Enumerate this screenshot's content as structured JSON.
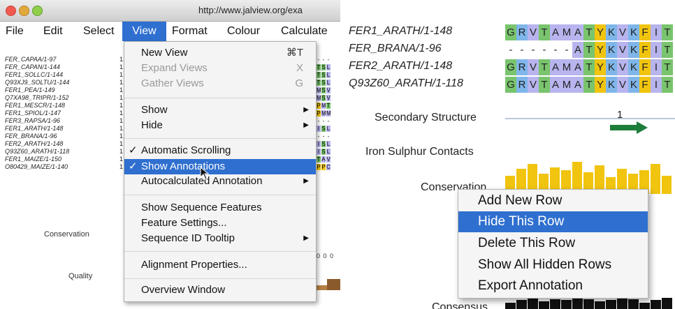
{
  "window": {
    "url": "http://www.jalview.org/exa"
  },
  "menubar": {
    "file": "File",
    "edit": "Edit",
    "select": "Select",
    "view": "View",
    "format": "Format",
    "colour": "Colour",
    "calculate": "Calculate"
  },
  "sequences": [
    "FER_CAPAA/1-97",
    "FER_CAPAN/1-144",
    "FER1_SOLLC/1-144",
    "Q93XJ9_SOLTU/1-144",
    "FER1_PEA/1-149",
    "Q7XA98_TRIPR/1-152",
    "FER1_MESCR/1-148",
    "FER1_SPIOL/1-147",
    "FER3_RAPSA/1-96",
    "FER1_ARATH/1-148",
    "FER_BRANA/1-96",
    "FER2_ARATH/1-148",
    "Q93Z60_ARATH/1-118",
    "FER1_MAIZE/1-150",
    "O80429_MAIZE/1-140"
  ],
  "seq_start": "1",
  "left_annotations": {
    "conservation": "Conservation",
    "quality": "Quality"
  },
  "left_residues": [
    [
      "-",
      "-",
      "-"
    ],
    [
      "T",
      "S",
      "L"
    ],
    [
      "T",
      "S",
      "L"
    ],
    [
      "T",
      "S",
      "L"
    ],
    [
      "M",
      "S",
      "V"
    ],
    [
      "M",
      "S",
      "V"
    ],
    [
      "P",
      "M",
      "T"
    ],
    [
      "P",
      "M",
      "M"
    ],
    [
      "-",
      "-",
      "-"
    ],
    [
      "I",
      "S",
      "L"
    ],
    [
      "-",
      "-",
      "-"
    ],
    [
      "I",
      "S",
      "L"
    ],
    [
      "I",
      "S",
      "L"
    ],
    [
      "T",
      "A",
      "V"
    ],
    [
      "P",
      "P",
      "C"
    ]
  ],
  "quality_text": "0 0 0",
  "view_menu": {
    "new_view": "New View",
    "new_view_shortcut": "⌘T",
    "expand_views": "Expand Views",
    "expand_views_shortcut": "X",
    "gather_views": "Gather Views",
    "gather_views_shortcut": "G",
    "show": "Show",
    "hide": "Hide",
    "automatic_scrolling": "Automatic Scrolling",
    "show_annotations": "Show Annotations",
    "autocalculated_annotation": "Autocalculated Annotation",
    "show_sequence_features": "Show Sequence Features",
    "feature_settings": "Feature Settings...",
    "sequence_id_tooltip": "Sequence ID Tooltip",
    "alignment_properties": "Alignment Properties...",
    "overview_window": "Overview Window",
    "check_glyph": "✓",
    "submenu_glyph": "▶"
  },
  "right_sequences": [
    {
      "id": "FER1_ARATH/1-148",
      "residues": [
        "G",
        "R",
        "V",
        "T",
        "A",
        "M",
        "A",
        "T",
        "Y",
        "K",
        "V",
        "K",
        "F",
        "I",
        "T"
      ]
    },
    {
      "id": "FER_BRANA/1-96",
      "residues": [
        "-",
        "-",
        "-",
        "-",
        "-",
        "-",
        "A",
        "T",
        "Y",
        "K",
        "V",
        "K",
        "F",
        "I",
        "T"
      ]
    },
    {
      "id": "FER2_ARATH/1-148",
      "residues": [
        "G",
        "R",
        "V",
        "T",
        "A",
        "M",
        "A",
        "T",
        "Y",
        "K",
        "V",
        "K",
        "F",
        "I",
        "T"
      ]
    },
    {
      "id": "Q93Z60_ARATH/1-118",
      "residues": [
        "G",
        "R",
        "V",
        "T",
        "A",
        "M",
        "A",
        "T",
        "Y",
        "K",
        "V",
        "K",
        "F",
        "I",
        "T"
      ]
    }
  ],
  "right_annotations": {
    "secondary_structure": "Secondary Structure",
    "secondary_structure_marker": "1",
    "iron_sulphur": "Iron Sulphur Contacts",
    "conservation": "Conservation",
    "consensus": "Consensus"
  },
  "conservation_levels": [
    0.55,
    0.75,
    0.9,
    0.6,
    0.8,
    0.7,
    0.95,
    0.65,
    0.85,
    0.5,
    0.75,
    0.6,
    0.7,
    0.9,
    0.55
  ],
  "context_menu": {
    "add_new_row": "Add New Row",
    "hide_this_row": "Hide This Row",
    "delete_this_row": "Delete This Row",
    "show_all_hidden_rows": "Show All Hidden Rows",
    "export_annotation": "Export Annotation"
  },
  "colors": {
    "selection": "#2f6fcf",
    "hydrophobic": "#b7b4ee",
    "aromatic": "#f1c40f",
    "positive": "#7fb6ea",
    "polar": "#79c46d",
    "helix_arrow": "#1e7d3a"
  }
}
